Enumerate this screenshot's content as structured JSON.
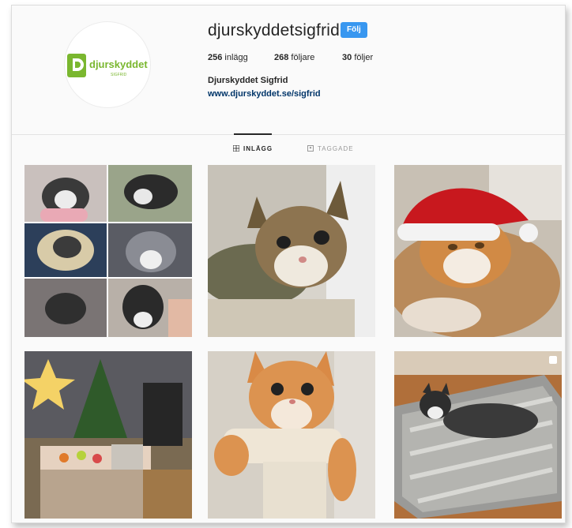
{
  "profile": {
    "username": "djurskyddetsigfrid",
    "follow_label": "Följ",
    "fullname": "Djurskyddet Sigfrid",
    "website": "www.djurskyddet.se/sigfrid",
    "logo": {
      "brand": "djurskyddet",
      "sub": "SIGFRID",
      "color": "#7ab72f"
    }
  },
  "stats": [
    {
      "value": "256",
      "label": "inlägg"
    },
    {
      "value": "268",
      "label": "följare"
    },
    {
      "value": "30",
      "label": "följer"
    }
  ],
  "tabs": [
    {
      "label": "INLÄGG",
      "icon": "grid-icon",
      "active": true
    },
    {
      "label": "TAGGADE",
      "icon": "tag-icon",
      "active": false
    }
  ],
  "colors": {
    "accent": "#3897f0",
    "link": "#003569"
  }
}
